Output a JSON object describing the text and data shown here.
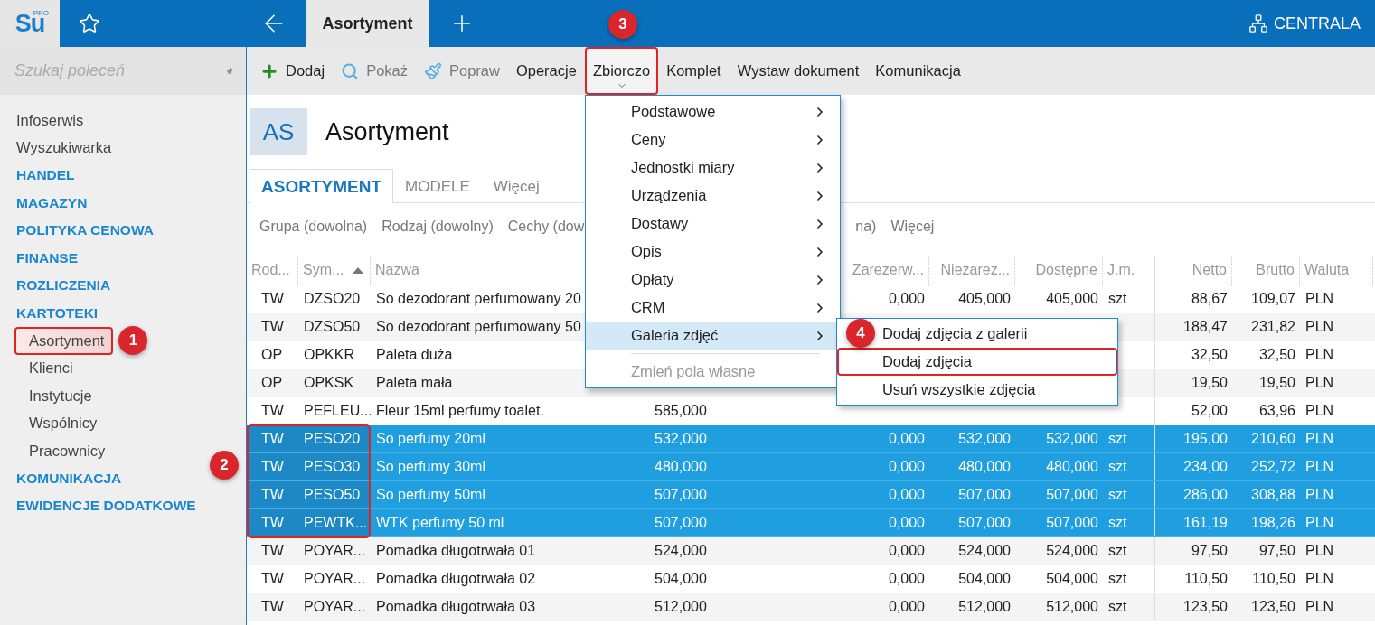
{
  "topbar": {
    "logo": "Su",
    "logo_badge": "PRO",
    "tab": "Asortyment",
    "server": "CENTRALA"
  },
  "sidebar": {
    "search": {
      "placeholder": "Szukaj poleceń"
    },
    "items": [
      {
        "label": "Infoserwis",
        "kind": "link"
      },
      {
        "label": "Wyszukiwarka",
        "kind": "link"
      },
      {
        "label": "HANDEL",
        "kind": "section"
      },
      {
        "label": "MAGAZYN",
        "kind": "section"
      },
      {
        "label": "POLITYKA CENOWA",
        "kind": "section"
      },
      {
        "label": "FINANSE",
        "kind": "section"
      },
      {
        "label": "ROZLICZENIA",
        "kind": "section"
      },
      {
        "label": "KARTOTEKI",
        "kind": "section",
        "children": [
          {
            "label": "Asortyment",
            "selected": true,
            "highlighted": true,
            "badge": "1"
          },
          {
            "label": "Klienci",
            "selected": false
          },
          {
            "label": "Instytucje",
            "selected": false
          },
          {
            "label": "Wspólnicy",
            "selected": false
          },
          {
            "label": "Pracownicy",
            "selected": false
          }
        ]
      },
      {
        "label": "KOMUNIKACJA",
        "kind": "section"
      },
      {
        "label": "EWIDENCJE DODATKOWE",
        "kind": "section"
      }
    ]
  },
  "toolbar": [
    {
      "label": "Dodaj",
      "disabled": false
    },
    {
      "label": "Pokaż",
      "disabled": true
    },
    {
      "label": "Popraw",
      "disabled": true
    },
    {
      "label": "Operacje",
      "disabled": false
    },
    {
      "label": "Zbiorczo",
      "disabled": false,
      "expanded": true,
      "highlighted": true,
      "badge": "3",
      "menu": [
        {
          "label": "Podstawowe",
          "kind": "submenu",
          "selected": false
        },
        {
          "label": "Ceny",
          "kind": "submenu",
          "selected": false
        },
        {
          "label": "Jednostki miary",
          "kind": "submenu",
          "selected": false
        },
        {
          "label": "Urządzenia",
          "kind": "submenu",
          "selected": false
        },
        {
          "label": "Dostawy",
          "kind": "submenu",
          "selected": false
        },
        {
          "label": "Opis",
          "kind": "submenu",
          "selected": false
        },
        {
          "label": "Opłaty",
          "kind": "submenu",
          "selected": false
        },
        {
          "label": "CRM",
          "kind": "submenu",
          "selected": false
        },
        {
          "label": "Galeria zdjęć",
          "kind": "submenu",
          "selected": true,
          "badge": "4",
          "submenu": [
            {
              "label": "Dodaj zdjęcia z galerii",
              "highlighted": false
            },
            {
              "label": "Dodaj zdjęcia",
              "highlighted": true
            },
            {
              "label": "Usuń wszystkie zdjęcia",
              "highlighted": false
            }
          ]
        },
        {
          "kind": "separator"
        },
        {
          "label": "Zmień pola własne",
          "kind": "action",
          "disabled": true,
          "selected": false
        }
      ]
    },
    {
      "label": "Komplet",
      "disabled": false
    },
    {
      "label": "Wystaw dokument",
      "disabled": false
    },
    {
      "label": "Komunikacja",
      "disabled": false
    }
  ],
  "header": {
    "badge": "AS",
    "title": "Asortyment"
  },
  "tabs": [
    {
      "label": "ASORTYMENT",
      "selected": true
    },
    {
      "label": "MODELE",
      "selected": false
    },
    {
      "label": "Więcej",
      "selected": false
    }
  ],
  "filters": [
    {
      "label": "Grupa (dowolna)",
      "kind": "chip"
    },
    {
      "label": "Rodzaj (dowolny)",
      "kind": "chip"
    },
    {
      "label": "Cechy (dow",
      "kind": "chip"
    },
    {
      "kind": "covered"
    },
    {
      "label": "na)",
      "kind": "chip"
    },
    {
      "label": "Więcej",
      "kind": "chip"
    }
  ],
  "table": {
    "columns": [
      {
        "label": "Rod..."
      },
      {
        "label": "Sym...",
        "sorted": true
      },
      {
        "label": "Nazwa"
      },
      {},
      {
        "label": "Zarezerw..."
      },
      {
        "label": "Niezarez..."
      },
      {
        "label": "Dostępne"
      },
      {
        "label": "J.m."
      },
      {
        "label": "Netto"
      },
      {
        "label": "Brutto"
      },
      {
        "label": "Waluta"
      }
    ],
    "badge": "2",
    "rows": [
      {
        "selected": false,
        "cells": [
          "TW",
          "DZSO20",
          "So dezodorant perfumowany 20",
          null,
          "0,000",
          "405,000",
          "405,000",
          "szt",
          "88,67",
          "109,07",
          "PLN"
        ]
      },
      {
        "selected": false,
        "cells": [
          "TW",
          "DZSO50",
          "So dezodorant perfumowany 50",
          null,
          null,
          null,
          null,
          null,
          "188,47",
          "231,82",
          "PLN"
        ]
      },
      {
        "selected": false,
        "cells": [
          "OP",
          "OPKKR",
          "Paleta duża",
          null,
          null,
          null,
          null,
          null,
          "32,50",
          "32,50",
          "PLN"
        ]
      },
      {
        "selected": false,
        "cells": [
          "OP",
          "OPKSK",
          "Paleta mała",
          null,
          null,
          null,
          null,
          null,
          "19,50",
          "19,50",
          "PLN"
        ]
      },
      {
        "selected": false,
        "cells": [
          "TW",
          "PEFLEU...",
          "Fleur 15ml perfumy toalet.",
          "585,000",
          null,
          null,
          null,
          null,
          "52,00",
          "63,96",
          "PLN"
        ]
      },
      {
        "selected": true,
        "cells": [
          "TW",
          "PESO20",
          "So perfumy 20ml",
          "532,000",
          "0,000",
          "532,000",
          "532,000",
          "szt",
          "195,00",
          "210,60",
          "PLN"
        ]
      },
      {
        "selected": true,
        "cells": [
          "TW",
          "PESO30",
          "So perfumy 30ml",
          "480,000",
          "0,000",
          "480,000",
          "480,000",
          "szt",
          "234,00",
          "252,72",
          "PLN"
        ]
      },
      {
        "selected": true,
        "cells": [
          "TW",
          "PESO50",
          "So perfumy 50ml",
          "507,000",
          "0,000",
          "507,000",
          "507,000",
          "szt",
          "286,00",
          "308,88",
          "PLN"
        ]
      },
      {
        "selected": true,
        "cells": [
          "TW",
          "PEWTK...",
          "WTK perfumy 50 ml",
          "507,000",
          "0,000",
          "507,000",
          "507,000",
          "szt",
          "161,19",
          "198,26",
          "PLN"
        ]
      },
      {
        "selected": false,
        "cells": [
          "TW",
          "POYAR...",
          "Pomadka długotrwała 01",
          "524,000",
          "0,000",
          "524,000",
          "524,000",
          "szt",
          "97,50",
          "97,50",
          "PLN"
        ]
      },
      {
        "selected": false,
        "cells": [
          "TW",
          "POYAR...",
          "Pomadka długotrwała 02",
          "504,000",
          "0,000",
          "504,000",
          "504,000",
          "szt",
          "110,50",
          "110,50",
          "PLN"
        ]
      },
      {
        "selected": false,
        "cells": [
          "TW",
          "POYAR...",
          "Pomadka długotrwała 03",
          "512,000",
          "0,000",
          "512,000",
          "512,000",
          "szt",
          "123,50",
          "123,50",
          "PLN"
        ]
      }
    ]
  }
}
